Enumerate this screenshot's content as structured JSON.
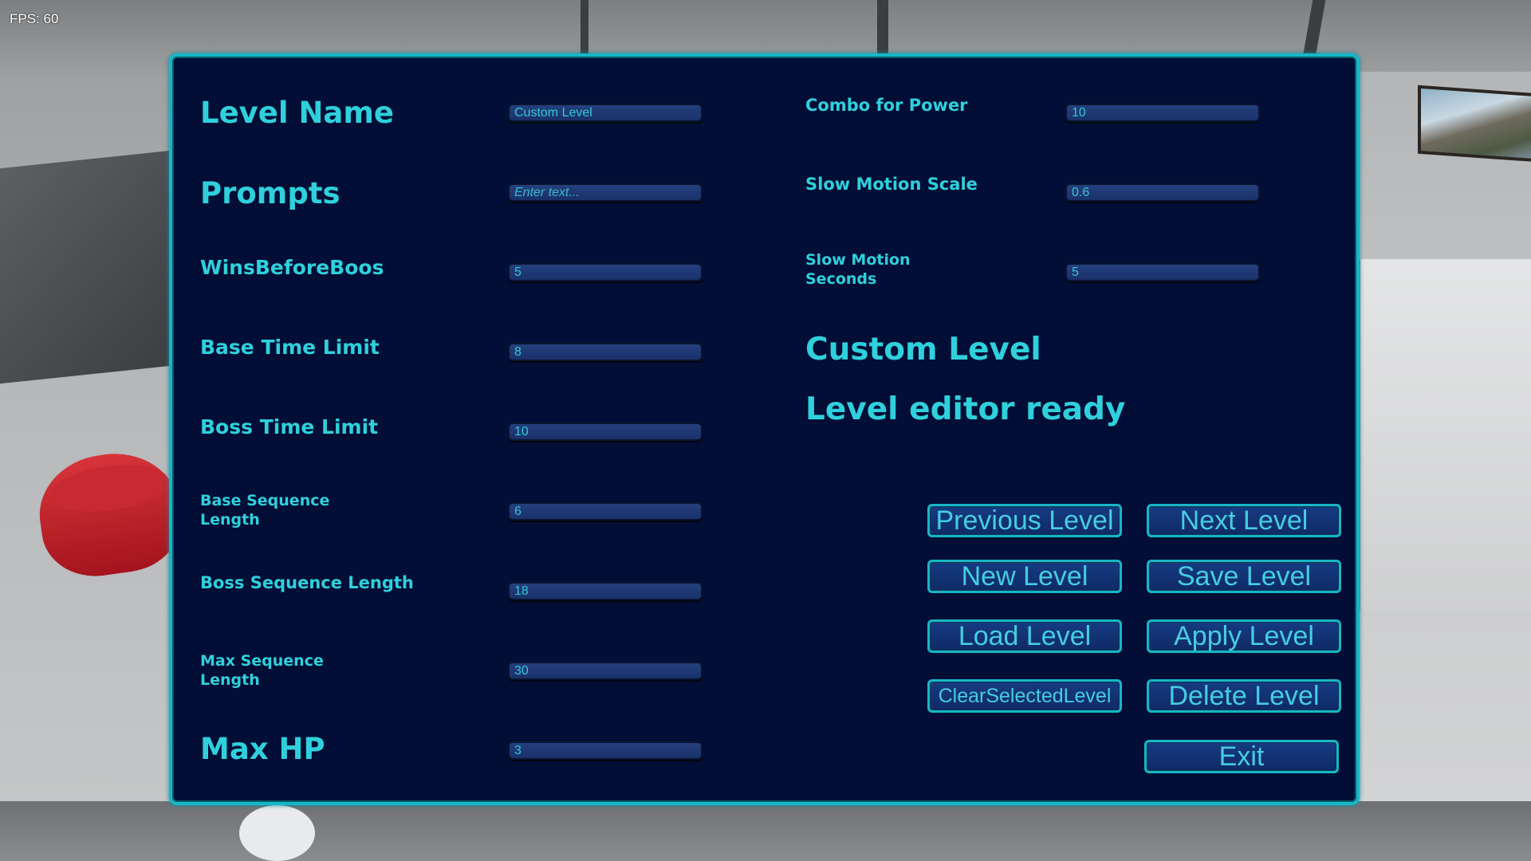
{
  "fps": "FPS: 60",
  "left_fields": [
    {
      "label": "Level Name",
      "value": "Custom Level"
    },
    {
      "label": "Prompts",
      "placeholder": "Enter text..."
    },
    {
      "label": "WinsBeforeBoos",
      "value": "5"
    },
    {
      "label": "Base Time Limit",
      "value": "8"
    },
    {
      "label": "Boss Time Limit",
      "value": "10"
    },
    {
      "label": "Base Sequence Length",
      "value": "6"
    },
    {
      "label": "Boss Sequence Length",
      "value": "18"
    },
    {
      "label": "Max Sequence Length",
      "value": "30"
    },
    {
      "label": "Max HP",
      "value": "3"
    }
  ],
  "right_fields": [
    {
      "label": "Combo for Power",
      "value": "10"
    },
    {
      "label": "Slow Motion Scale",
      "value": "0.6"
    },
    {
      "label": "Slow Motion Seconds",
      "value": "5"
    }
  ],
  "current_level_name": "Custom Level",
  "status_message": "Level editor ready",
  "buttons": {
    "previous": "Previous Level",
    "next": "Next Level",
    "new": "New Level",
    "save": "Save Level",
    "load": "Load Level",
    "apply": "Apply Level",
    "clear": "ClearSelectedLevel",
    "delete": "Delete Level",
    "exit": "Exit"
  },
  "colors": {
    "panel_bg": "#020e35",
    "accent": "#15b7c9",
    "label_text": "#2fd0dc",
    "field_bg": "#24407e"
  }
}
